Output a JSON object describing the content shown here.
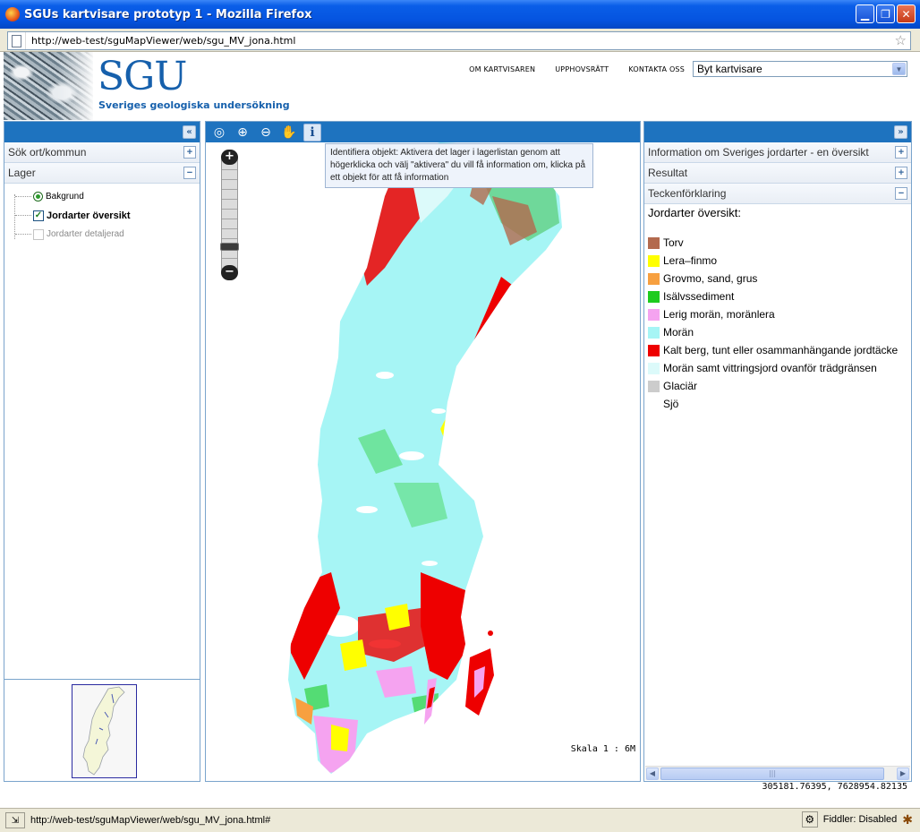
{
  "window": {
    "title": "SGUs kartvisare prototyp 1 - Mozilla Firefox",
    "controls": [
      "minimize",
      "maximize",
      "close"
    ]
  },
  "browser": {
    "url": "http://web-test/sguMapViewer/web/sgu_MV_jona.html",
    "status_url": "http://web-test/sguMapViewer/web/sgu_MV_jona.html#",
    "fiddler": "Fiddler: Disabled"
  },
  "header": {
    "logo": "SGU",
    "org_name": "Sveriges geologiska undersökning",
    "nav": [
      "OM KARTVISAREN",
      "UPPHOVSRÄTT",
      "KONTAKTA OSS"
    ],
    "selector_value": "Byt kartvisare"
  },
  "left_panel": {
    "sections": [
      {
        "label": "Sök ort/kommun",
        "toggle": "+"
      },
      {
        "label": "Lager",
        "toggle": "−"
      }
    ],
    "layers": [
      {
        "label": "Bakgrund",
        "control": "radio",
        "checked": true
      },
      {
        "label": "Jordarter översikt",
        "control": "checkbox",
        "checked": true
      },
      {
        "label": "Jordarter detaljerad",
        "control": "checkbox",
        "checked": false
      }
    ]
  },
  "map": {
    "tools": [
      "zoom-extent-icon",
      "zoom-in-icon",
      "zoom-out-icon",
      "pan-hand-icon",
      "identify-icon"
    ],
    "active_tool": "identify-icon",
    "tooltip": "Identifiera objekt: Aktivera det lager i lagerlistan genom att högerklicka och välj \"aktivera\" du vill få information om, klicka på ett objekt för att få information",
    "scale": "Skala 1 : 6M",
    "zoom_in": "+",
    "zoom_out": "−"
  },
  "right_panel": {
    "sections": [
      {
        "label": "Information om Sveriges jordarter - en översikt",
        "toggle": "+"
      },
      {
        "label": "Resultat",
        "toggle": "+"
      },
      {
        "label": "Teckenförklaring",
        "toggle": "−"
      }
    ],
    "legend_title": "Jordarter översikt:",
    "legend": [
      {
        "label": "Torv",
        "color": "#b36a4e"
      },
      {
        "label": "Lera–finmo",
        "color": "#ffff00"
      },
      {
        "label": "Grovmo, sand, grus",
        "color": "#f7a040"
      },
      {
        "label": "Isälvssediment",
        "color": "#1ecb1e"
      },
      {
        "label": "Lerig morän, moränlera",
        "color": "#f5a3f0"
      },
      {
        "label": "Morän",
        "color": "#a6f5f5"
      },
      {
        "label": "Kalt berg, tunt eller osammanhängande jordtäcke",
        "color": "#ee0000"
      },
      {
        "label": "Morän samt vittringsjord ovanför trädgränsen",
        "color": "#dcfafa"
      },
      {
        "label": "Glaciär",
        "color": "#cccccc"
      },
      {
        "label": "Sjö",
        "color": "#ffffff"
      }
    ]
  },
  "coordinates": "305181.76395, 7628954.82135"
}
